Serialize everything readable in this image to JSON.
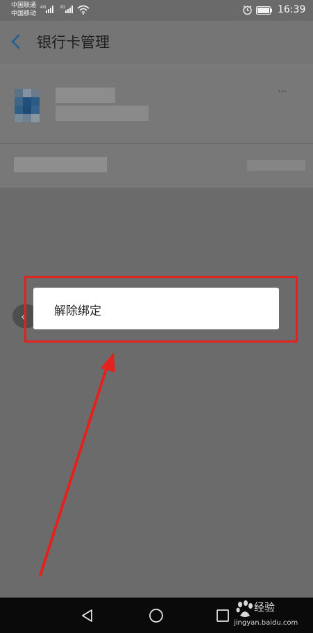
{
  "status_bar": {
    "carrier_primary": "中国联通",
    "carrier_secondary": "中国移动",
    "network_primary": "4G",
    "network_secondary": "2G",
    "time": "16:39",
    "icons": [
      "signal-icon",
      "wifi-icon",
      "alarm-icon",
      "battery-icon"
    ]
  },
  "header": {
    "title": "银行卡管理",
    "back_icon": "back-arrow-icon"
  },
  "card": {
    "more_icon": "more-dots-icon",
    "more_label": "···"
  },
  "popup": {
    "unbind_label": "解除绑定"
  },
  "collapse_handle": {
    "icon": "chevron-left-icon",
    "glyph": "‹"
  },
  "annotation": {
    "highlight_color": "#e3221d",
    "arrow_color": "#e3221d"
  },
  "navigation": {
    "icons": [
      "back-triangle-icon",
      "home-circle-icon",
      "recents-square-icon"
    ]
  },
  "watermark": {
    "brand": "经验",
    "url": "jingyan.baidu.com"
  }
}
